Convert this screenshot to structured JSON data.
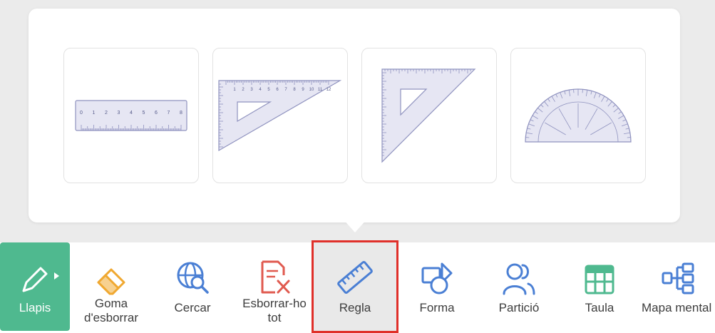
{
  "ruler_options": [
    {
      "name": "straight-ruler",
      "ticks": [
        "0",
        "1",
        "2",
        "3",
        "4",
        "5",
        "6",
        "7",
        "8"
      ]
    },
    {
      "name": "set-square-30-60",
      "ticks": [
        "1",
        "2",
        "3",
        "4",
        "5",
        "6",
        "7",
        "8",
        "9",
        "10",
        "11",
        "12"
      ]
    },
    {
      "name": "set-square-45"
    },
    {
      "name": "protractor"
    }
  ],
  "toolbar": {
    "pencil_label": "Llapis",
    "eraser_label_line1": "Goma",
    "eraser_label_line2": "d'esborrar",
    "search_label": "Cercar",
    "clear_label_line1": "Esborrar-ho",
    "clear_label_line2": "tot",
    "ruler_label": "Regla",
    "shape_label": "Forma",
    "partition_label": "Partició",
    "table_label": "Taula",
    "mindmap_label": "Mapa mental"
  },
  "colors": {
    "accent_green": "#4fb98f",
    "icon_blue": "#4a7fd4",
    "icon_orange": "#f0a830",
    "icon_red": "#e05a4f",
    "highlight_red": "#e0302a"
  }
}
